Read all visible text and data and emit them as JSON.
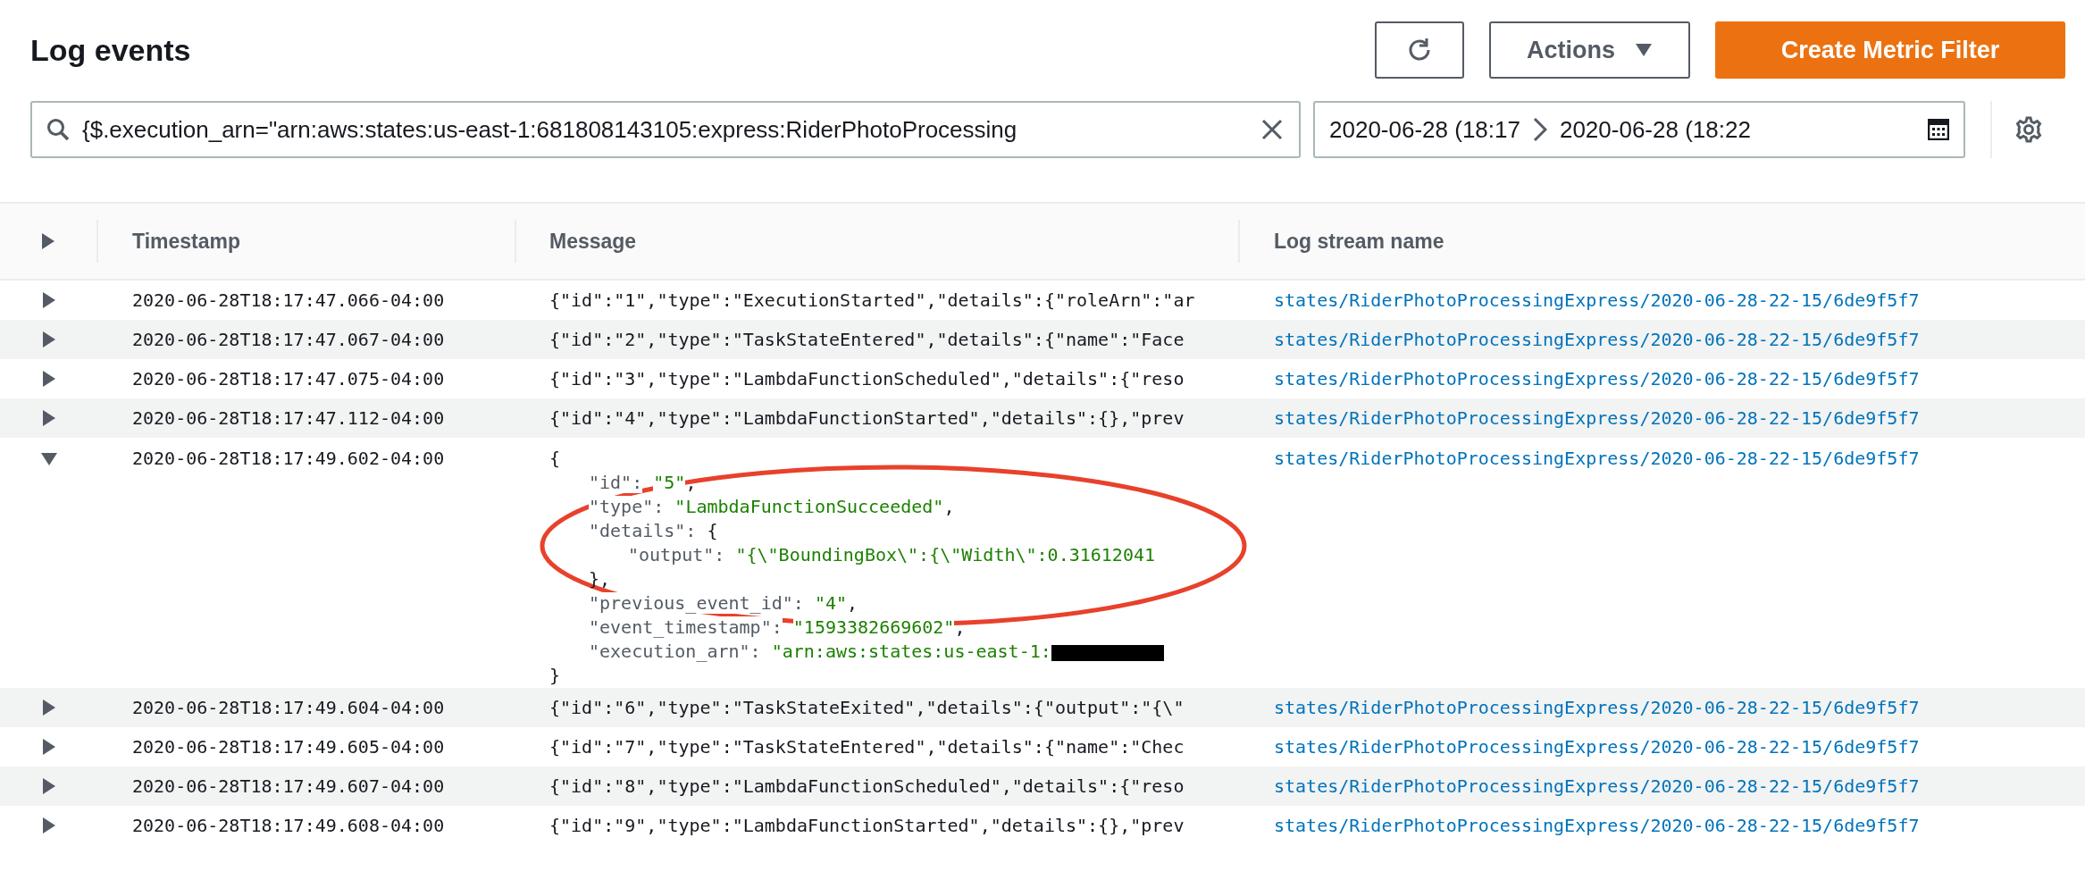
{
  "header": {
    "title": "Log events",
    "actions_button": "Actions",
    "create_button": "Create Metric Filter"
  },
  "filter": {
    "search_value": "{$.execution_arn=\"arn:aws:states:us-east-1:681808143105:express:RiderPhotoProcessing",
    "date_start": "2020-06-28 (18:17",
    "date_end": "2020-06-28 (18:22"
  },
  "table": {
    "columns": [
      "Timestamp",
      "Message",
      "Log stream name"
    ],
    "rows": [
      {
        "timestamp": "2020-06-28T18:17:47.066-04:00",
        "message": "{\"id\":\"1\",\"type\":\"ExecutionStarted\",\"details\":{\"roleArn\":\"ar",
        "log_stream": "states/RiderPhotoProcessingExpress/2020-06-28-22-15/6de9f5f7",
        "expanded": false
      },
      {
        "timestamp": "2020-06-28T18:17:47.067-04:00",
        "message": "{\"id\":\"2\",\"type\":\"TaskStateEntered\",\"details\":{\"name\":\"Face",
        "log_stream": "states/RiderPhotoProcessingExpress/2020-06-28-22-15/6de9f5f7",
        "expanded": false
      },
      {
        "timestamp": "2020-06-28T18:17:47.075-04:00",
        "message": "{\"id\":\"3\",\"type\":\"LambdaFunctionScheduled\",\"details\":{\"reso",
        "log_stream": "states/RiderPhotoProcessingExpress/2020-06-28-22-15/6de9f5f7",
        "expanded": false
      },
      {
        "timestamp": "2020-06-28T18:17:47.112-04:00",
        "message": "{\"id\":\"4\",\"type\":\"LambdaFunctionStarted\",\"details\":{},\"prev",
        "log_stream": "states/RiderPhotoProcessingExpress/2020-06-28-22-15/6de9f5f7",
        "expanded": false
      },
      {
        "timestamp": "2020-06-28T18:17:49.602-04:00",
        "log_stream": "states/RiderPhotoProcessingExpress/2020-06-28-22-15/6de9f5f7",
        "expanded": true,
        "detail": {
          "open": "{",
          "close": "}",
          "fields": [
            {
              "key": "\"id\":",
              "value": "\"5\"",
              "trail": ","
            },
            {
              "key": "\"type\":",
              "value": "\"LambdaFunctionSucceeded\"",
              "trail": ","
            },
            {
              "key": "\"details\":",
              "open": "{",
              "close": "},",
              "children": [
                {
                  "key": "\"output\":",
                  "value": "\"{\\\"BoundingBox\\\":{\\\"Width\\\":0.31612041"
                }
              ]
            },
            {
              "key": "\"previous_event_id\":",
              "value": "\"4\"",
              "trail": ","
            },
            {
              "key": "\"event_timestamp\":",
              "value": "\"1593382669602\"",
              "trail": ","
            },
            {
              "key": "\"execution_arn\":",
              "value": "\"arn:aws:states:us-east-1:",
              "redacted": true
            }
          ]
        }
      },
      {
        "timestamp": "2020-06-28T18:17:49.604-04:00",
        "message": "{\"id\":\"6\",\"type\":\"TaskStateExited\",\"details\":{\"output\":\"{\\\"",
        "log_stream": "states/RiderPhotoProcessingExpress/2020-06-28-22-15/6de9f5f7",
        "expanded": false
      },
      {
        "timestamp": "2020-06-28T18:17:49.605-04:00",
        "message": "{\"id\":\"7\",\"type\":\"TaskStateEntered\",\"details\":{\"name\":\"Chec",
        "log_stream": "states/RiderPhotoProcessingExpress/2020-06-28-22-15/6de9f5f7",
        "expanded": false
      },
      {
        "timestamp": "2020-06-28T18:17:49.607-04:00",
        "message": "{\"id\":\"8\",\"type\":\"LambdaFunctionScheduled\",\"details\":{\"reso",
        "log_stream": "states/RiderPhotoProcessingExpress/2020-06-28-22-15/6de9f5f7",
        "expanded": false
      },
      {
        "timestamp": "2020-06-28T18:17:49.608-04:00",
        "message": "{\"id\":\"9\",\"type\":\"LambdaFunctionStarted\",\"details\":{},\"prev",
        "log_stream": "states/RiderPhotoProcessingExpress/2020-06-28-22-15/6de9f5f7",
        "expanded": false
      }
    ]
  }
}
